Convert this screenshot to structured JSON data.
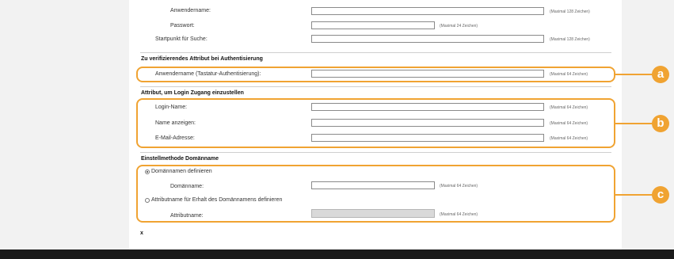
{
  "top": {
    "username_label": "Anwendername:",
    "username_hint": "(Maximal 128 Zeichen)",
    "password_label": "Passwort:",
    "password_hint": "(Maximal 24 Zeichen)",
    "search_start_label": "Startpunkt für Suche:",
    "search_start_hint": "(Maximal 128 Zeichen)"
  },
  "section_verify": {
    "title": "Zu verifizierendes Attribut bei Authentisierung",
    "username_key_label": "Anwendername (Tastatur-Authentisierung):",
    "username_key_hint": "(Maximal 64 Zeichen)"
  },
  "section_login": {
    "title": "Attribut, um Login Zugang einzustellen",
    "login_name_label": "Login-Name:",
    "login_name_hint": "(Maximal 64 Zeichen)",
    "display_name_label": "Name anzeigen:",
    "display_name_hint": "(Maximal 64 Zeichen)",
    "email_label": "E-Mail-Adresse:",
    "email_hint": "(Maximal 64 Zeichen)"
  },
  "section_domain": {
    "title": "Einstellmethode Domänname",
    "option_define": "Domännamen definieren",
    "domain_label": "Domänname:",
    "domain_hint": "(Maximal 64 Zeichen)",
    "option_attribute": "Attributname für Erhalt des Domännamens definieren",
    "attribute_label": "Attributname:",
    "attribute_hint": "(Maximal 64 Zeichen)"
  },
  "footer_mark": "x",
  "callouts": [
    "a",
    "b",
    "c"
  ],
  "colors": {
    "accent": "#f0a332",
    "bottom_bar": "#1a1a1a"
  }
}
